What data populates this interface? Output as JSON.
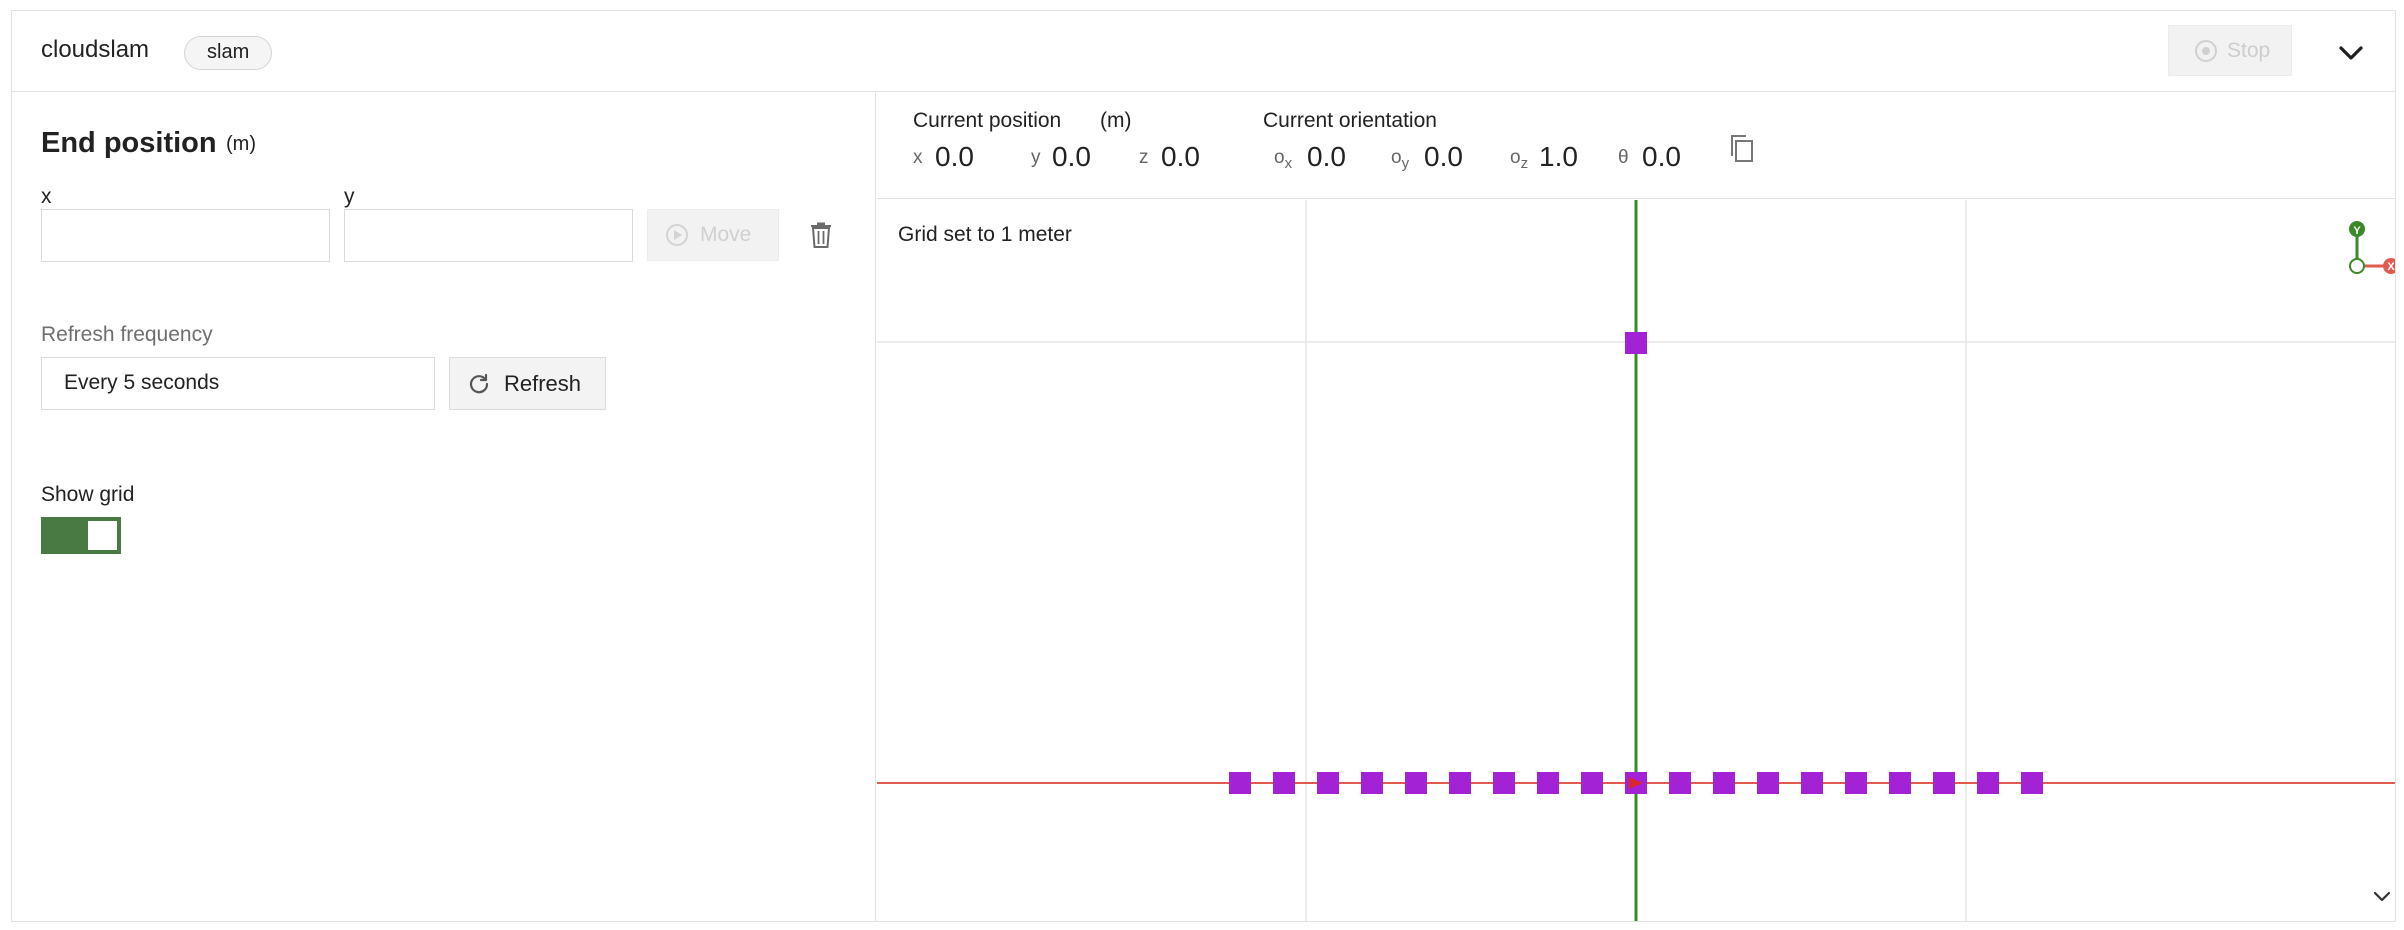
{
  "header": {
    "title": "cloudslam",
    "chip": "slam",
    "stop_label": "Stop"
  },
  "end_position": {
    "title": "End position",
    "unit": "(m)",
    "x_label": "x",
    "y_label": "y",
    "x_value": "",
    "y_value": "",
    "move_label": "Move"
  },
  "refresh": {
    "label": "Refresh frequency",
    "selected": "Every 5 seconds",
    "button_label": "Refresh"
  },
  "grid_toggle": {
    "label": "Show grid",
    "on": true
  },
  "current_position": {
    "title": "Current position",
    "unit": "(m)",
    "x_label": "x",
    "x": "0.0",
    "y_label": "y",
    "y": "0.0",
    "z_label": "z",
    "z": "0.0"
  },
  "current_orientation": {
    "title": "Current orientation",
    "ox_label": "o",
    "ox_sub": "x",
    "ox": "0.0",
    "oy_label": "o",
    "oy_sub": "y",
    "oy": "0.0",
    "oz_label": "o",
    "oz_sub": "z",
    "oz": "1.0",
    "theta_label": "θ",
    "theta": "0.0"
  },
  "map": {
    "grid_note": "Grid set to 1 meter",
    "compass_x": "X",
    "compass_y": "Y",
    "colors": {
      "x_axis": "#e05a4e",
      "y_axis": "#3a8a2a",
      "points": "#a322d6",
      "robot": "#d9272e"
    },
    "points": [
      [
        -9,
        0
      ],
      [
        -8,
        0
      ],
      [
        -7,
        0
      ],
      [
        -6,
        0
      ],
      [
        -5,
        0
      ],
      [
        -4,
        0
      ],
      [
        -3,
        0
      ],
      [
        -2,
        0
      ],
      [
        -1,
        0
      ],
      [
        1,
        0
      ],
      [
        2,
        0
      ],
      [
        3,
        0
      ],
      [
        4,
        0
      ],
      [
        5,
        0
      ],
      [
        6,
        0
      ],
      [
        7,
        0
      ],
      [
        8,
        0
      ],
      [
        9,
        0
      ],
      [
        0,
        10
      ]
    ],
    "robot_position": [
      0,
      0
    ]
  },
  "icons": {
    "stop": "stop-circle-icon",
    "collapse": "chevron-down-icon",
    "move": "play-circle-icon",
    "delete": "trash-icon",
    "refresh": "refresh-icon",
    "copy": "copy-icon",
    "map_expand": "chevron-down-icon"
  }
}
